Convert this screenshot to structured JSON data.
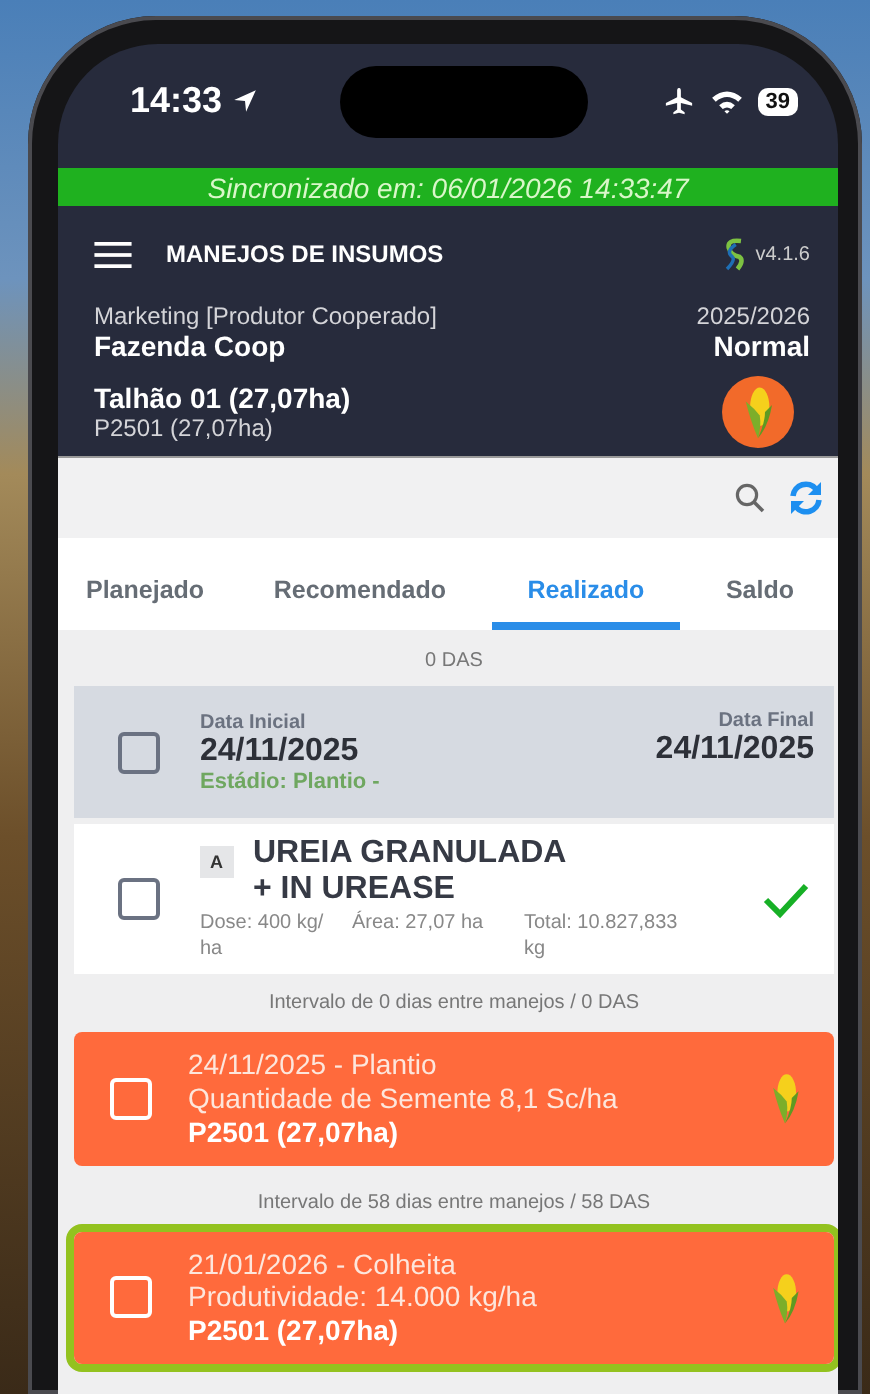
{
  "status_bar": {
    "time": "14:33",
    "battery": "39"
  },
  "sync_banner": "Sincronizado em: 06/01/2026 14:33:47",
  "header": {
    "title": "MANEJOS DE INSUMOS",
    "version": "v4.1.6",
    "user": "Marketing [Produtor Cooperado]",
    "farm": "Fazenda Coop",
    "season": "2025/2026",
    "season_type": "Normal",
    "field": "Talhão 01 (27,07ha)",
    "plot": "P2501 (27,07ha)"
  },
  "tabs": [
    {
      "label": "Planejado",
      "selected": false
    },
    {
      "label": "Recomendado",
      "selected": false
    },
    {
      "label": "Realizado",
      "selected": true
    },
    {
      "label": "Saldo",
      "selected": false
    }
  ],
  "das_label": "0 DAS",
  "application": {
    "checked": false,
    "start_label": "Data Inicial",
    "start_date": "24/11/2025",
    "end_label": "Data Final",
    "end_date": "24/11/2025",
    "stage": "Estádio: Plantio -",
    "product": {
      "badge": "A",
      "name": "UREIA GRANULADA + IN UREASE",
      "dose": "Dose: 400 kg/ ha",
      "area": "Área: 27,07 ha",
      "total": "Total: 10.827,833 kg",
      "done": true,
      "checked": false
    }
  },
  "events": [
    {
      "interval": "Intervalo de 0 dias entre manejos / 0 DAS",
      "title": "24/11/2025 - Plantio",
      "detail": "Quantidade de Semente 8,1 Sc/ha",
      "plot": "P2501 (27,07ha)",
      "checked": false,
      "selected": false
    },
    {
      "interval": "Intervalo de 58 dias entre manejos / 58 DAS",
      "title": "21/01/2026 - Colheita",
      "detail": "Produtividade: 14.000 kg/ha",
      "plot": "P2501 (27,07ha)",
      "checked": false,
      "selected": true
    }
  ]
}
